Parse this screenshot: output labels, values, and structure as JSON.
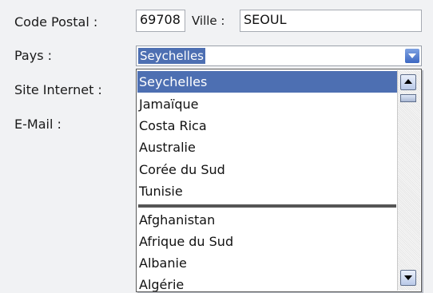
{
  "form": {
    "code_postal_label": "Code Postal :",
    "code_postal_value": "69708",
    "ville_label": "Ville :",
    "ville_value": "SEOUL",
    "pays_label": "Pays :",
    "site_internet_label": "Site Internet :",
    "email_label": "E-Mail :"
  },
  "pays_select": {
    "selected_value": "Seychelles",
    "options": [
      "Seychelles",
      "Jamaïque",
      "Costa Rica",
      "Australie",
      "Corée du Sud",
      "Tunisie",
      "Afghanistan",
      "Afrique du Sud",
      "Albanie",
      "Algérie"
    ]
  },
  "colors": {
    "selection": "#4d6fb2",
    "background": "#f1f2f4"
  },
  "icons": {
    "dropdown_arrow": "chevron-down-icon",
    "scroll_up": "arrow-up-icon",
    "scroll_down": "arrow-down-icon"
  }
}
